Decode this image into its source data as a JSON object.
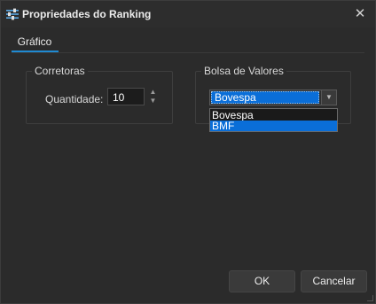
{
  "window": {
    "title": "Propriedades do Ranking",
    "icon": "sliders-icon",
    "close_glyph": "✕"
  },
  "tabs": [
    {
      "label": "Gráfico",
      "active": true
    }
  ],
  "corretoras": {
    "legend": "Corretoras",
    "quantity_label": "Quantidade:",
    "quantity_value": "10"
  },
  "bolsa": {
    "legend": "Bolsa de Valores",
    "selected": "Bovespa",
    "options": [
      "Bovespa",
      "BMF"
    ],
    "highlighted_option": "BMF"
  },
  "buttons": {
    "ok": "OK",
    "cancel": "Cancelar"
  },
  "colors": {
    "accent": "#1f8ad2",
    "selection": "#0a6ed8",
    "background": "#2b2b2b"
  }
}
